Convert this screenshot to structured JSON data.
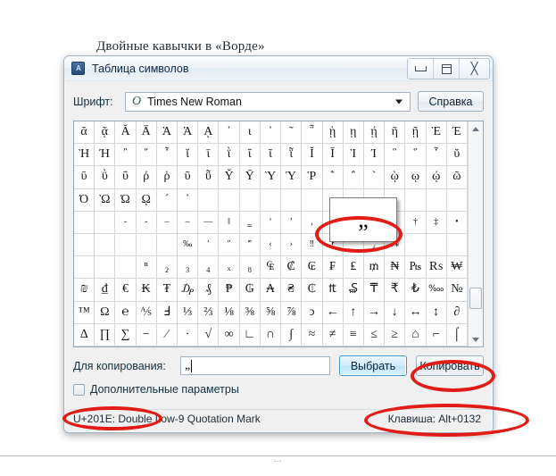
{
  "background_document": {
    "text": "Двойные кавычки в «Ворде»"
  },
  "window": {
    "title": "Таблица символов",
    "app_icon": "charmap-icon",
    "controls": {
      "minimize": "minimize-icon",
      "maximize": "maximize-icon",
      "close": "close-icon"
    }
  },
  "font_row": {
    "label": "Шрифт:",
    "selected_font": "Times New Roman",
    "combo_glyph": "O",
    "dropdown_icon": "chevron-down-icon",
    "help_button": "Справка"
  },
  "grid": {
    "columns": 19,
    "rows": [
      [
        "ᾶ",
        "ᾷ",
        "Ᾰ",
        "Ᾱ",
        "Ὰ",
        "Ά",
        "ᾼ",
        "᾽",
        "ι",
        "᾿",
        "῀",
        "῁",
        "ῂ",
        "ῃ",
        "ῄ",
        "ῆ",
        "ῇ",
        "Ὲ",
        "Έ"
      ],
      [
        "Ὴ",
        "Ή",
        "῍",
        "῎",
        "῏",
        "ῐ",
        "ῑ",
        "ῒ",
        "ΐ",
        "ῖ",
        "ῗ",
        "Ῐ",
        "Ῑ",
        "Ὶ",
        "Ί",
        "῝",
        "῞",
        "῟",
        "ῠ"
      ],
      [
        "ῡ",
        "ῢ",
        "ΰ",
        "ῤ",
        "ῥ",
        "ῦ",
        "ῧ",
        "Ῠ",
        "Ῡ",
        "Ὺ",
        "Ύ",
        "Ῥ",
        "῭",
        "΅",
        "`",
        "ῲ",
        "ῳ",
        "ῴ",
        "ῶ"
      ],
      [
        "Ό",
        "Ὼ",
        "Ώ",
        "ῼ",
        "´",
        "῾",
        "",
        "",
        "",
        "",
        "",
        "",
        "",
        "",
        "",
        "",
        "",
        "",
        ""
      ],
      [
        "",
        "",
        "‐",
        "‑",
        "‒",
        "–",
        "—",
        "‖",
        "‗",
        "‘",
        "’",
        "‚",
        "‛",
        "",
        "",
        "",
        "†",
        "‡",
        "•"
      ],
      [
        "",
        "",
        "",
        "",
        "",
        "‰",
        "′",
        "″",
        "‴",
        "‹",
        "›",
        "‼",
        "‽",
        "‾",
        "⁁",
        "⁂",
        "",
        "",
        ""
      ],
      [
        "",
        "",
        "",
        "ⁿ",
        "₂",
        "₃",
        "₄",
        "ₓ",
        "₈",
        "₠",
        "₡",
        "₢",
        "₣",
        "₤",
        "₥",
        "₦",
        "₧",
        "₨",
        "₩"
      ],
      [
        "₪",
        "₫",
        "€",
        "₭",
        "₮",
        "₯",
        "₰",
        "₱",
        "₲",
        "₳",
        "₴",
        "₵",
        "₶",
        "₷",
        "₸",
        "₹",
        "₺",
        "‱",
        "№"
      ],
      [
        "™",
        "Ω",
        "℮",
        "⅍",
        "Ⅎ",
        "⅓",
        "⅔",
        "⅛",
        "⅜",
        "⅝",
        "⅞",
        "ↄ",
        "←",
        "↑",
        "→",
        "↓",
        "↔",
        "↕",
        "∂"
      ],
      [
        "∆",
        "∏",
        "∑",
        "−",
        "∕",
        "∙",
        "√",
        "∞",
        "∟",
        "∩",
        "∫",
        "≈",
        "≠",
        "≡",
        "≤",
        "≥",
        "⌂",
        "⌐",
        "⌠"
      ]
    ],
    "magnifier_char": "„",
    "scrollbar": {
      "up_icon": "scroll-up-arrow-icon",
      "down_icon": "scroll-down-arrow-icon",
      "thumb": "scrollbar-thumb"
    }
  },
  "copy_row": {
    "label": "Для копирования:",
    "input_value": "„",
    "input_placeholder": "",
    "select_button": "Выбрать",
    "copy_button": "Копировать"
  },
  "advanced": {
    "label": "Дополнительные параметры",
    "checked": false
  },
  "statusbar": {
    "left": "U+201E: Double Low-9 Quotation Mark",
    "right": "Клавиша: Alt+0132"
  },
  "annotations": {
    "color": "#e11b15",
    "items": [
      "magnified-character-preview",
      "copy-button",
      "unicode-code-point",
      "keyboard-shortcut"
    ]
  },
  "page_divider": {
    "grip": "⋯"
  }
}
